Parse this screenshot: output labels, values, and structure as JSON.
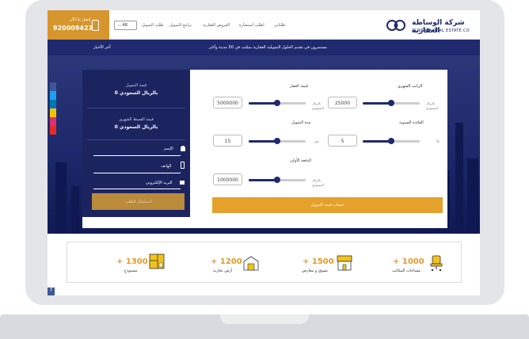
{
  "header": {
    "call_label": "إتصل بنا الآن",
    "phone": "920009423",
    "language": "AR",
    "nav": [
      "طلب التمويل",
      "برامج التمويل",
      "العروض العقارية",
      "اطلب استشارة",
      "طلباتي"
    ],
    "logo_ar": "شركة الوساطة العقارية",
    "logo_en": "ALWSATA REAL ESTATE CO"
  },
  "ticker": {
    "heading": "آخر الأخبار",
    "text": "مستمرون في تقديم الحلول التمويلية العقارية بمكتب في 50 مدينة وأكثر"
  },
  "social": [
    "f",
    "t",
    "in",
    "y",
    "ig",
    "yt"
  ],
  "calculator": {
    "summary": [
      {
        "label": "قيمة التمويل",
        "value": "0 بالريال السعودي"
      },
      {
        "label": "قيمة القسط الشهري",
        "value": "0 بالريال السعودي"
      }
    ],
    "fields": {
      "name": "الإسم",
      "phone": "الهاتف",
      "email": "البريد الإلكتروني"
    },
    "submit": "استكمال الطلب",
    "salary_label": "الراتب الشهري",
    "salary_value": "25000",
    "salary_unit": "بالريال السعودي",
    "salary_level": 0.5,
    "property_label": "قيمة العقار",
    "property_value": "5000000",
    "property_unit": "بالريال السعودي",
    "property_level": 0.5,
    "rate_label": "الفائدة السنوية",
    "rate_value": "5",
    "rate_unit": "%",
    "rate_level": 0.5,
    "duration_label": "مدة التمويل",
    "duration_value": "15",
    "duration_unit": "عام",
    "duration_level": 0.5,
    "down_label": "الدفعة الأولى",
    "down_value": "1000000",
    "down_unit": "بالريال السعودي",
    "down_level": 0.5,
    "calc_button": "حساب قيمة التمويل"
  },
  "stats": [
    {
      "num": "+ 1000",
      "label": "مساحات المكاتب",
      "icon": "office-chair-icon"
    },
    {
      "num": "+ 1500",
      "label": "تسوق و معارض",
      "icon": "shop-icon"
    },
    {
      "num": "+ 1200",
      "label": "أرض تجارية",
      "icon": "warehouse-icon"
    },
    {
      "num": "+ 1300",
      "label": "مستودع",
      "icon": "floorplan-icon"
    }
  ],
  "colors": {
    "navy": "#1c2460",
    "gold": "#e4a22c",
    "brown": "#b98b3b"
  }
}
